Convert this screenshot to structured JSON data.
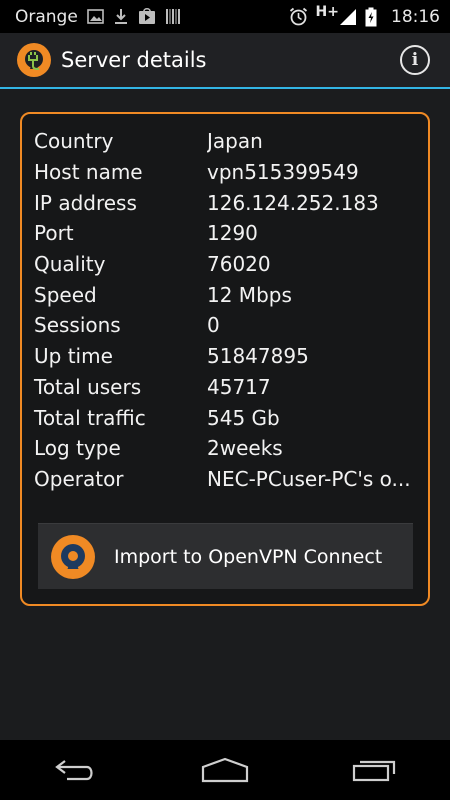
{
  "status_bar": {
    "carrier": "Orange",
    "network": "H+",
    "time": "18:16"
  },
  "action_bar": {
    "title": "Server details",
    "info_icon": "info-icon",
    "info_glyph": "i"
  },
  "details": [
    {
      "label": "Country",
      "value": "Japan"
    },
    {
      "label": "Host name",
      "value": "vpn515399549"
    },
    {
      "label": "IP address",
      "value": "126.124.252.183"
    },
    {
      "label": "Port",
      "value": "1290"
    },
    {
      "label": "Quality",
      "value": "76020"
    },
    {
      "label": "Speed",
      "value": "12 Mbps"
    },
    {
      "label": "Sessions",
      "value": "0"
    },
    {
      "label": "Up time",
      "value": "51847895"
    },
    {
      "label": "Total users",
      "value": "45717"
    },
    {
      "label": "Total traffic",
      "value": "545 Gb"
    },
    {
      "label": "Log type",
      "value": "2weeks"
    },
    {
      "label": "Operator",
      "value": "NEC-PCuser-PC's o..."
    }
  ],
  "import_button": {
    "label": "Import to OpenVPN Connect",
    "icon": "openvpn-icon"
  },
  "colors": {
    "accent_orange": "#f08a24",
    "actionbar_divider": "#33b5e5",
    "background": "#1b1c1e"
  }
}
